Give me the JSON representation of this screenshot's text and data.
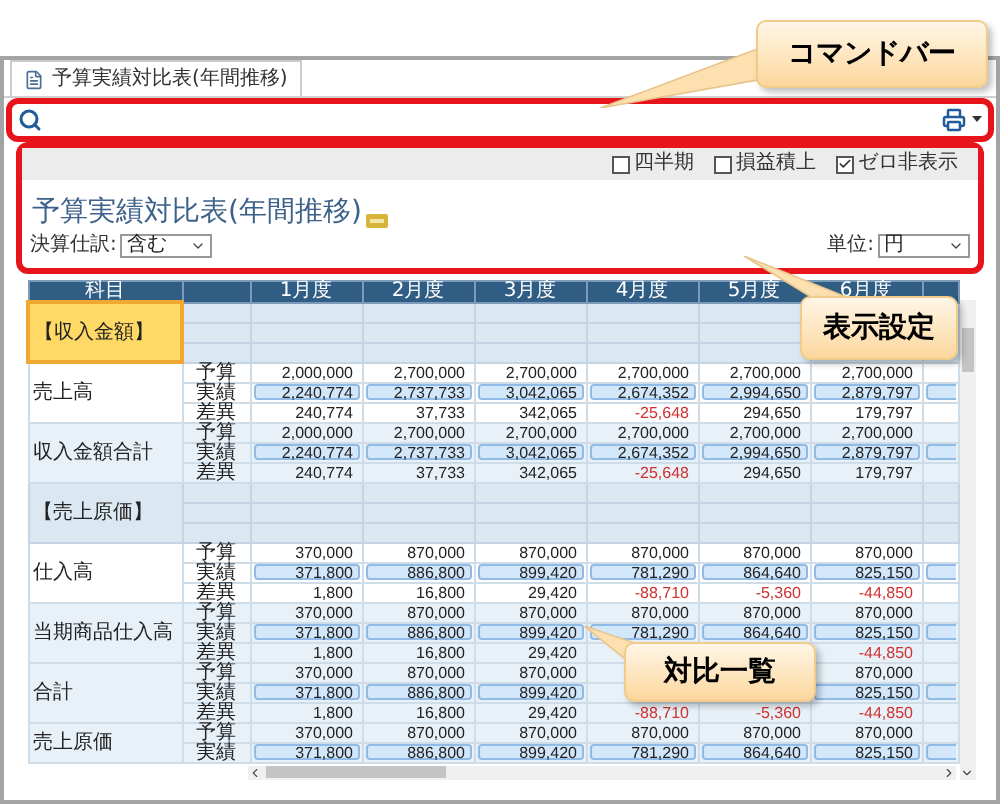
{
  "tab": {
    "title": "予算実績対比表(年間推移)"
  },
  "options": [
    {
      "label": "四半期",
      "checked": false
    },
    {
      "label": "損益積上",
      "checked": false
    },
    {
      "label": "ゼロ非表示",
      "checked": true
    }
  ],
  "report": {
    "title": "予算実績対比表(年間推移)"
  },
  "filters": [
    {
      "label": "決算仕訳:",
      "value": "含む"
    },
    {
      "label": "単位:",
      "value": "円"
    }
  ],
  "table": {
    "subject_header": "科目",
    "months": [
      "1月度",
      "2月度",
      "3月度",
      "4月度",
      "5月度",
      "6月度"
    ],
    "sections": [
      {
        "title": "【収入金額】",
        "selected": true,
        "items": [
          {
            "name": "売上高",
            "rows": [
              {
                "kind": "budget",
                "label": "予算",
                "cells": {
                  "month_1": "2,000,000",
                  "month_2": "2,700,000",
                  "month_3": "2,700,000",
                  "month_4": "2,700,000",
                  "month_5": "2,700,000",
                  "month_6": "2,700,000"
                }
              },
              {
                "kind": "actual",
                "label": "実績",
                "cells": {
                  "month_1": "2,240,774",
                  "month_2": "2,737,733",
                  "month_3": "3,042,065",
                  "month_4": "2,674,352",
                  "month_5": "2,994,650",
                  "month_6": "2,879,797"
                }
              },
              {
                "kind": "variance",
                "label": "差異",
                "cells": {
                  "month_1": {
                    "text": "240,774",
                    "negative": false
                  },
                  "month_2": {
                    "text": "37,733",
                    "negative": false
                  },
                  "month_3": {
                    "text": "342,065",
                    "negative": false
                  },
                  "month_4": {
                    "text": "-25,648",
                    "negative": true
                  },
                  "month_5": {
                    "text": "294,650",
                    "negative": false
                  },
                  "month_6": {
                    "text": "179,797",
                    "negative": false
                  }
                }
              }
            ]
          },
          {
            "name": "収入金額合計",
            "rows": [
              {
                "kind": "budget",
                "label": "予算",
                "cells": {
                  "month_1": "2,000,000",
                  "month_2": "2,700,000",
                  "month_3": "2,700,000",
                  "month_4": "2,700,000",
                  "month_5": "2,700,000",
                  "month_6": "2,700,000"
                }
              },
              {
                "kind": "actual",
                "label": "実績",
                "cells": {
                  "month_1": "2,240,774",
                  "month_2": "2,737,733",
                  "month_3": "3,042,065",
                  "month_4": "2,674,352",
                  "month_5": "2,994,650",
                  "month_6": "2,879,797"
                }
              },
              {
                "kind": "variance",
                "label": "差異",
                "cells": {
                  "month_1": {
                    "text": "240,774",
                    "negative": false
                  },
                  "month_2": {
                    "text": "37,733",
                    "negative": false
                  },
                  "month_3": {
                    "text": "342,065",
                    "negative": false
                  },
                  "month_4": {
                    "text": "-25,648",
                    "negative": true
                  },
                  "month_5": {
                    "text": "294,650",
                    "negative": false
                  },
                  "month_6": {
                    "text": "179,797",
                    "negative": false
                  }
                }
              }
            ]
          }
        ]
      },
      {
        "title": "【売上原価】",
        "selected": false,
        "items": [
          {
            "name": "仕入高",
            "rows": [
              {
                "kind": "budget",
                "label": "予算",
                "cells": {
                  "month_1": "370,000",
                  "month_2": "870,000",
                  "month_3": "870,000",
                  "month_4": "870,000",
                  "month_5": "870,000",
                  "month_6": "870,000"
                }
              },
              {
                "kind": "actual",
                "label": "実績",
                "cells": {
                  "month_1": "371,800",
                  "month_2": "886,800",
                  "month_3": "899,420",
                  "month_4": "781,290",
                  "month_5": "864,640",
                  "month_6": "825,150"
                }
              },
              {
                "kind": "variance",
                "label": "差異",
                "cells": {
                  "month_1": {
                    "text": "1,800",
                    "negative": false
                  },
                  "month_2": {
                    "text": "16,800",
                    "negative": false
                  },
                  "month_3": {
                    "text": "29,420",
                    "negative": false
                  },
                  "month_4": {
                    "text": "-88,710",
                    "negative": true
                  },
                  "month_5": {
                    "text": "-5,360",
                    "negative": true
                  },
                  "month_6": {
                    "text": "-44,850",
                    "negative": true
                  }
                }
              }
            ]
          },
          {
            "name": "当期商品仕入高",
            "rows": [
              {
                "kind": "budget",
                "label": "予算",
                "cells": {
                  "month_1": "370,000",
                  "month_2": "870,000",
                  "month_3": "870,000",
                  "month_4": "870,000",
                  "month_5": "870,000",
                  "month_6": "870,000"
                }
              },
              {
                "kind": "actual",
                "label": "実績",
                "cells": {
                  "month_1": "371,800",
                  "month_2": "886,800",
                  "month_3": "899,420",
                  "month_4": "781,290",
                  "month_5": "864,640",
                  "month_6": "825,150"
                }
              },
              {
                "kind": "variance",
                "label": "差異",
                "cells": {
                  "month_1": {
                    "text": "1,800",
                    "negative": false
                  },
                  "month_2": {
                    "text": "16,800",
                    "negative": false
                  },
                  "month_3": {
                    "text": "29,420",
                    "negative": false
                  },
                  "month_6": {
                    "text": "-44,850",
                    "negative": true
                  }
                }
              }
            ]
          },
          {
            "name": "合計",
            "rows": [
              {
                "kind": "budget",
                "label": "予算",
                "cells": {
                  "month_1": "370,000",
                  "month_2": "870,000",
                  "month_3": "870,000",
                  "month_6": "870,000"
                }
              },
              {
                "kind": "actual",
                "label": "実績",
                "cells": {
                  "month_1": "371,800",
                  "month_2": "886,800",
                  "month_3": "899,420",
                  "month_6": "825,150"
                }
              },
              {
                "kind": "variance",
                "label": "差異",
                "cells": {
                  "month_1": {
                    "text": "1,800",
                    "negative": false
                  },
                  "month_2": {
                    "text": "16,800",
                    "negative": false
                  },
                  "month_3": {
                    "text": "29,420",
                    "negative": false
                  },
                  "month_4": {
                    "text": "-88,710",
                    "negative": true
                  },
                  "month_5": {
                    "text": "-5,360",
                    "negative": true
                  },
                  "month_6": {
                    "text": "-44,850",
                    "negative": true
                  }
                }
              }
            ]
          },
          {
            "name": "売上原価",
            "rows": [
              {
                "kind": "budget",
                "label": "予算",
                "cells": {
                  "month_1": "370,000",
                  "month_2": "870,000",
                  "month_3": "870,000",
                  "month_4": "870,000",
                  "month_5": "870,000",
                  "month_6": "870,000"
                }
              },
              {
                "kind": "actual",
                "label": "実績",
                "cells": {
                  "month_1": "371,800",
                  "month_2": "886,800",
                  "month_3": "899,420",
                  "month_4": "781,290",
                  "month_5": "864,640",
                  "month_6": "825,150"
                }
              }
            ]
          }
        ]
      }
    ]
  },
  "callouts": {
    "command_bar": "コマンドバー",
    "display_settings": "表示設定",
    "comparison_list": "対比一覧"
  }
}
